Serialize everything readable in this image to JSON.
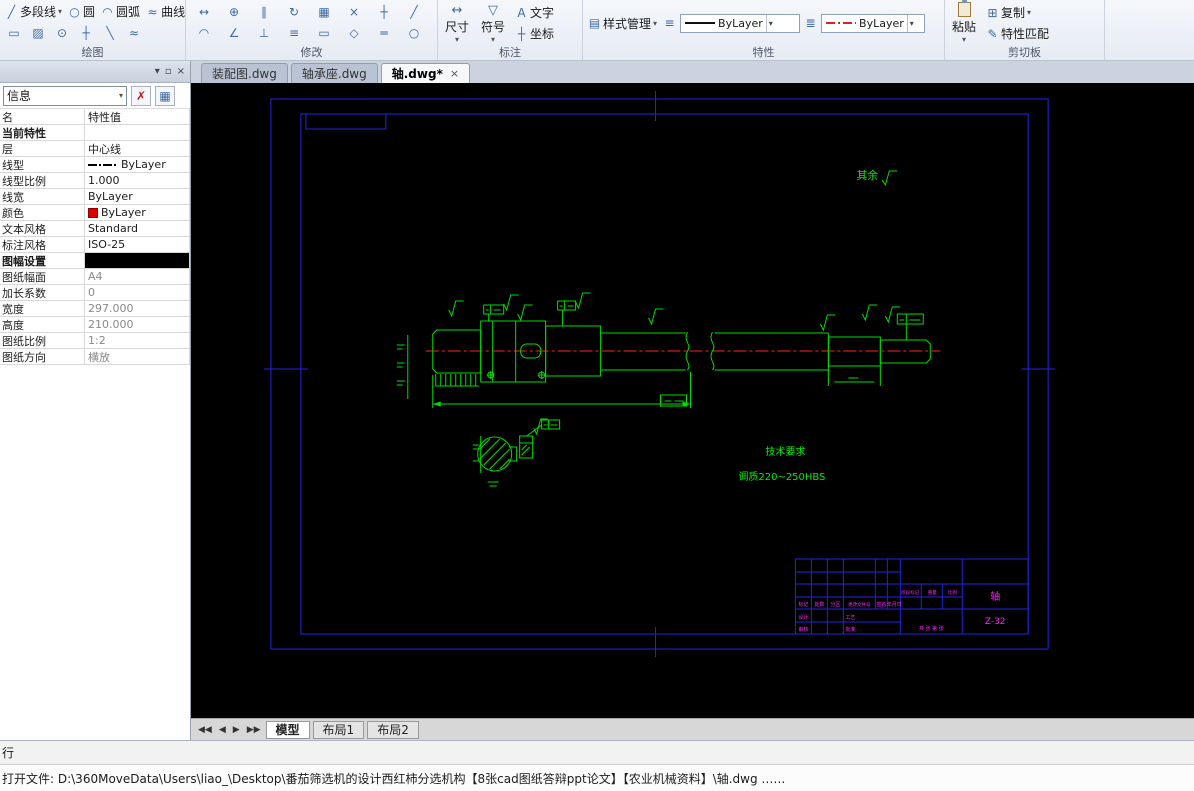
{
  "icons": {
    "dropdown": "▾",
    "close": "×",
    "float": "▫",
    "polyline": "╱",
    "circle": "○",
    "arc": "◠",
    "curve": "≈",
    "rect": "▭",
    "hatch": "▨",
    "point": "⊙",
    "center_mark": "┼",
    "segment": "╲",
    "spline": "≈",
    "move": "↔",
    "copy_tool": "⊕",
    "mirror": "∥",
    "rotate": "↻",
    "array": "▦",
    "erase": "×",
    "trim": "┼",
    "extend": "╱",
    "fillet": "◠",
    "chamfer": "∠",
    "break": "⊥",
    "stretch": "≡",
    "scale": "▭",
    "explode": "◇",
    "offset": "═",
    "node_edit": "○",
    "dimension": "↔",
    "symbol": "▽",
    "text": "A",
    "coordinate": "┼",
    "style_manager": "▤",
    "layer_list": "≡",
    "lineweight": "≣",
    "copy": "⊞",
    "match_brush": "✎",
    "filter_edit": "✗",
    "filter_grid": "▦",
    "nav_first": "◀",
    "nav_prev": "◀",
    "nav_next": "▶",
    "nav_last": "▶"
  },
  "ribbon": {
    "groups": {
      "draw": {
        "label": "绘图",
        "polyline": "多段线",
        "circle": "圆",
        "arc": "圆弧",
        "curve": "曲线"
      },
      "modify": {
        "label": "修改"
      },
      "annotate": {
        "label": "标注",
        "dimension": "尺寸",
        "symbol": "符号",
        "text": "文字",
        "coordinate": "坐标"
      },
      "properties": {
        "label": "特性",
        "style_manager": "样式管理",
        "linetype_value": "ByLayer",
        "color_linetype_value": "ByLayer"
      },
      "clipboard": {
        "label": "剪切板",
        "paste": "粘贴",
        "copy": "复制",
        "match_properties": "特性匹配"
      }
    }
  },
  "palette": {
    "filter_value": "信息",
    "columns": [
      "名",
      "特性值"
    ],
    "sections": [
      {
        "title": "当前特性",
        "rows": [
          {
            "label": "层",
            "value": "中心线"
          },
          {
            "label": "线型",
            "value": "ByLayer"
          },
          {
            "label": "线型比例",
            "value": "1.000"
          },
          {
            "label": "线宽",
            "value": "ByLayer"
          },
          {
            "label": "颜色",
            "value": "ByLayer"
          },
          {
            "label": "文本风格",
            "value": "Standard"
          },
          {
            "label": "标注风格",
            "value": "ISO-25"
          }
        ]
      },
      {
        "title": "图幅设置",
        "rows": [
          {
            "label": "图纸幅面",
            "value": "A4"
          },
          {
            "label": "加长系数",
            "value": "0"
          },
          {
            "label": "宽度",
            "value": "297.000"
          },
          {
            "label": "高度",
            "value": "210.000"
          },
          {
            "label": "图纸比例",
            "value": "1:2"
          },
          {
            "label": "图纸方向",
            "value": "横放"
          }
        ]
      }
    ]
  },
  "doc_tabs": [
    {
      "label": "装配图.dwg"
    },
    {
      "label": "轴承座.dwg"
    },
    {
      "label": "轴.dwg*"
    }
  ],
  "drawing": {
    "surface_note": "其余",
    "tech_title": "技术要求",
    "tech_line1": "调质220~250HBS",
    "title_block": {
      "part_name": "轴",
      "drawing_number": "Z-32",
      "labels": [
        "标记",
        "处数",
        "分区",
        "更改文件号",
        "签名",
        "年月日",
        "设计",
        "审核",
        "工艺",
        "批准",
        "阶段标记",
        "重量",
        "比例",
        "共 张 第 张"
      ]
    }
  },
  "layout_tabs": [
    {
      "label": "模型"
    },
    {
      "label": "布局1"
    },
    {
      "label": "布局2"
    }
  ],
  "command_line": {
    "text": "行"
  },
  "status_bar": {
    "text": "打开文件: D:\\360MoveData\\Users\\liao_\\Desktop\\番茄筛选机的设计西红柿分选机构【8张cad图纸答辩ppt论文】【农业机械资料】\\轴.dwg ……"
  },
  "colors": {
    "paper_border": "#2323e6",
    "geometry": "#00dd00",
    "centerline": "#ff2222",
    "annotation": "#ff22ff",
    "bylayer_swatch": "#dd0000"
  }
}
